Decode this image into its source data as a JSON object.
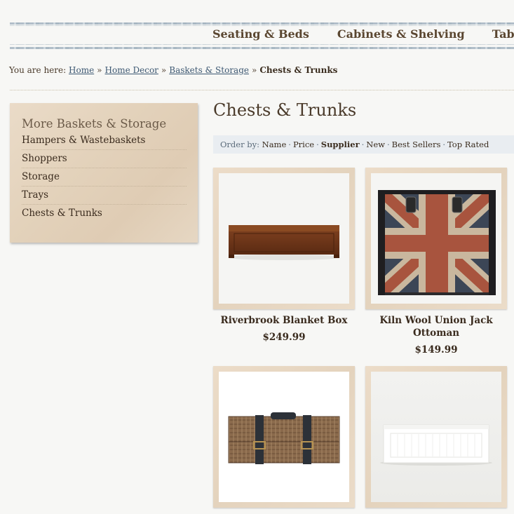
{
  "nav": {
    "items": [
      "Seating & Beds",
      "Cabinets & Shelving",
      "Tables"
    ]
  },
  "breadcrumb": {
    "prefix": "You are here:",
    "links": [
      "Home",
      "Home Decor",
      "Baskets & Storage"
    ],
    "separator": "»",
    "current": "Chests & Trunks"
  },
  "sidebar": {
    "title": "More Baskets & Storage",
    "items": [
      "Hampers & Wastebaskets",
      "Shoppers",
      "Storage",
      "Trays",
      "Chests & Trunks"
    ]
  },
  "page_title": "Chests & Trunks",
  "order_by": {
    "label": "Order by:",
    "options": [
      "Name",
      "Price",
      "Supplier",
      "New",
      "Best Sellers",
      "Top Rated"
    ],
    "active": "Supplier"
  },
  "products": [
    {
      "name": "Riverbrook Blanket Box",
      "price": "$249.99",
      "image_icon": "wooden-blanket-box-image"
    },
    {
      "name": "Kiln Wool Union Jack Ottoman",
      "price": "$149.99",
      "image_icon": "union-jack-trunk-image"
    },
    {
      "name": "",
      "price": "",
      "image_icon": "wicker-hamper-image"
    },
    {
      "name": "",
      "price": "",
      "image_icon": "white-storage-chest-image"
    }
  ],
  "colors": {
    "link": "#3d5872",
    "text": "#4a3a2a",
    "frame": "#e4d3bd",
    "order_bar": "#e9edf1"
  }
}
